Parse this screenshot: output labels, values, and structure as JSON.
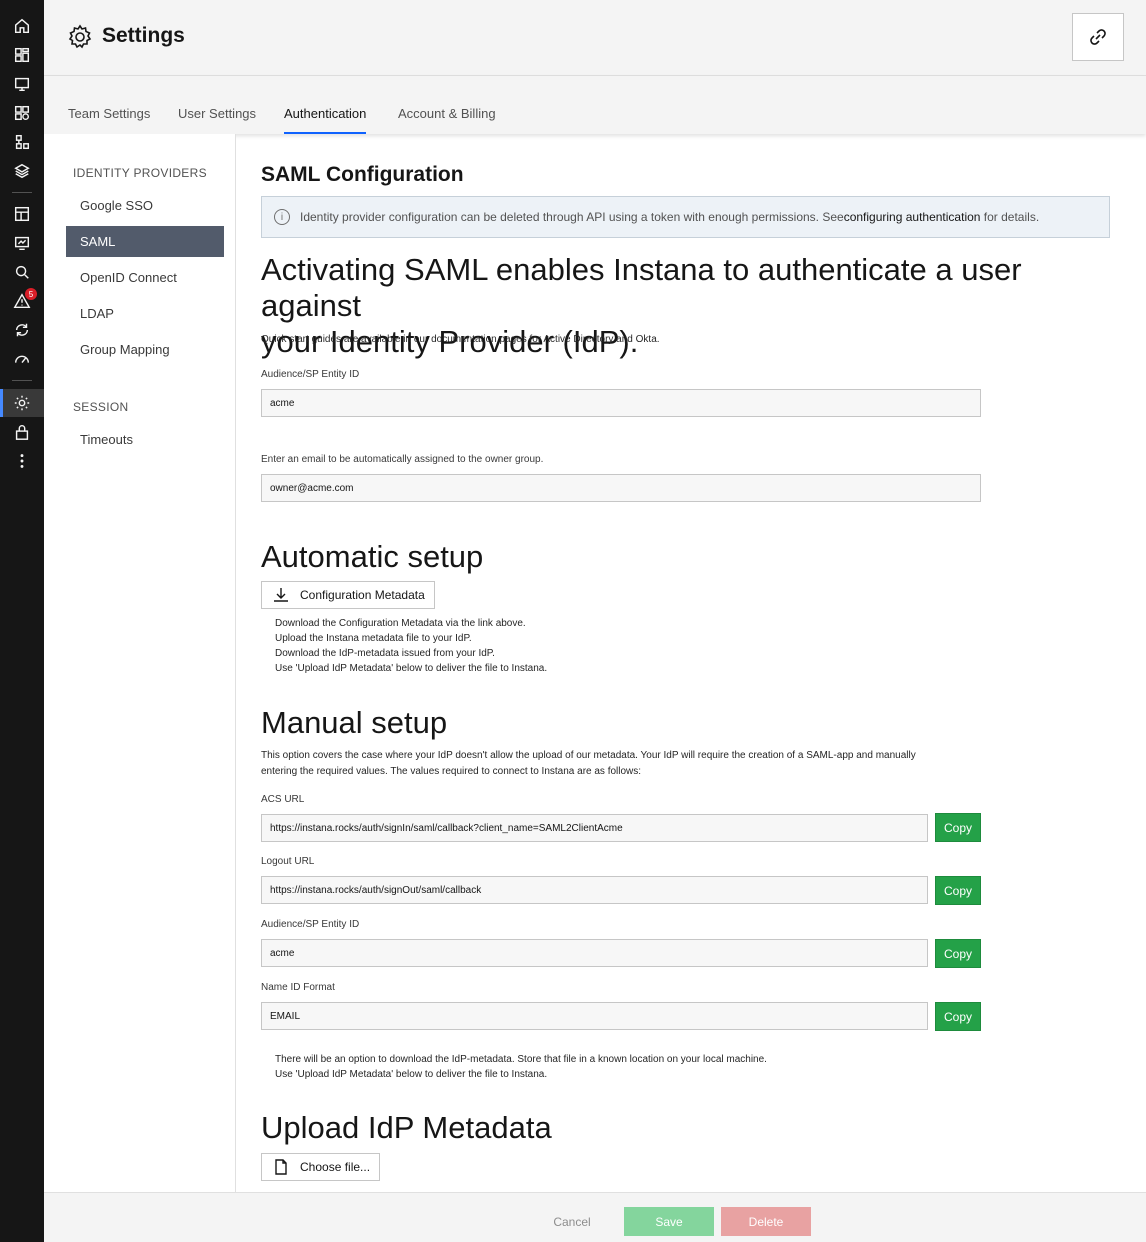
{
  "rail": {
    "items": [
      "home-icon",
      "dashboard-icon",
      "website-monitoring-icon",
      "applications-icon",
      "services-icon",
      "infrastructure-icon",
      "synthetic-icon",
      "platform-icon",
      "analytics-icon",
      "events-icon",
      "automation-icon",
      "slo-icon",
      "settings-icon",
      "lock-icon",
      "more-icon"
    ],
    "event_badge": "5"
  },
  "header": {
    "title": "Settings"
  },
  "tabs": [
    {
      "label": "Team Settings",
      "active": false
    },
    {
      "label": "User Settings",
      "active": false
    },
    {
      "label": "Authentication",
      "active": true
    },
    {
      "label": "Account & Billing",
      "active": false
    }
  ],
  "subnav": {
    "identity_heading": "IDENTITY PROVIDERS",
    "identity_items": [
      "Google SSO",
      "SAML",
      "OpenID Connect",
      "LDAP",
      "Group Mapping"
    ],
    "active_item": "SAML",
    "session_heading": "SESSION",
    "session_items": [
      "Timeouts"
    ]
  },
  "main": {
    "section_title": "SAML Configuration",
    "notice": {
      "text_before": "Identity provider configuration can be deleted through API using a token with enough permissions. See ",
      "link": "configuring authentication",
      "text_after": " for details."
    },
    "intro_line1": "Activating SAML enables Instana to authenticate a user against",
    "intro_line2": "your Identity Provider (IdP).",
    "quickstart": "Quick start guides are available in our documentation pages for Active Directory and Okta.",
    "entity_label": "Audience/SP Entity ID",
    "entity_value": "acme",
    "owner_label": "Enter an email to be automatically assigned to the owner group.",
    "owner_value": "owner@acme.com",
    "automatic": {
      "heading": "Automatic setup",
      "button": "Configuration Metadata",
      "steps": [
        "Download the Configuration Metadata via the link above.",
        "Upload the Instana metadata file to your IdP.",
        "Download the IdP-metadata issued from your IdP.",
        "Use 'Upload IdP Metadata' below to deliver the file to Instana."
      ]
    },
    "manual": {
      "heading": "Manual setup",
      "desc_line1": "This option covers the case where your IdP doesn't allow the upload of our metadata. Your IdP will require the creation of a SAML-app and manually",
      "desc_line2": "entering the required values. The values required to connect to Instana are as follows:",
      "fields": [
        {
          "label": "ACS URL",
          "value": "https://instana.rocks/auth/signIn/saml/callback?client_name=SAML2ClientAcme"
        },
        {
          "label": "Logout URL",
          "value": "https://instana.rocks/auth/signOut/saml/callback"
        },
        {
          "label": "Audience/SP Entity ID",
          "value": "acme"
        },
        {
          "label": "Name ID Format",
          "value": "EMAIL"
        }
      ],
      "copy_label": "Copy",
      "note_line1": "There will be an option to download the IdP-metadata. Store that file in a known location on your local machine.",
      "note_line2": "Use 'Upload IdP Metadata' below to deliver the file to Instana."
    },
    "upload": {
      "heading": "Upload IdP Metadata",
      "button": "Choose file..."
    }
  },
  "footer": {
    "cancel": "Cancel",
    "save": "Save",
    "delete": "Delete"
  },
  "colors": {
    "rail_bg": "#161616",
    "active_subnav": "#525b6b",
    "copy_green": "#24a148",
    "save_disabled": "#84d59d",
    "delete_disabled": "#e8a2a2",
    "tab_underline": "#0f62fe"
  }
}
